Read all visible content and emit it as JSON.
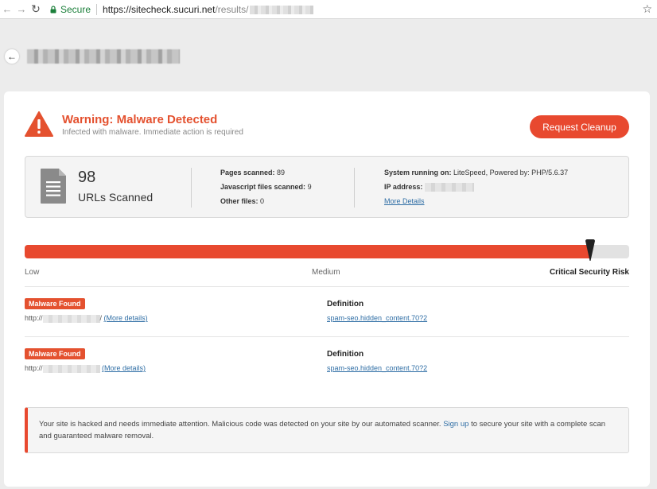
{
  "browser": {
    "secure_label": "Secure",
    "url_host": "https://sitecheck.sucuri.net",
    "url_path": "/results/",
    "back_icon": "arrow-left-icon",
    "forward_icon": "arrow-right-icon",
    "reload_icon": "reload-icon",
    "bookmark_icon": "star-icon"
  },
  "warning": {
    "title": "Warning: Malware Detected",
    "subtitle": "Infected with malware. Immediate action is required",
    "cleanup_button": "Request Cleanup",
    "icon": "warning-triangle-icon"
  },
  "stats": {
    "urls_count": "98",
    "urls_label": "URLs Scanned",
    "pages_label": "Pages scanned:",
    "pages_value": "89",
    "js_label": "Javascript files scanned:",
    "js_value": "9",
    "other_label": "Other files:",
    "other_value": "0",
    "system_label": "System running on:",
    "system_value": "LiteSpeed, Powered by: PHP/5.6.37",
    "ip_label": "IP address:",
    "more_details": "More Details"
  },
  "risk": {
    "level_fraction": 0.935,
    "low": "Low",
    "medium": "Medium",
    "high": "Critical Security Risk"
  },
  "findings": [
    {
      "badge": "Malware Found",
      "url_prefix": "http://",
      "url_suffix": "/",
      "more": "(More details)",
      "definition_label": "Definition",
      "definition": "spam-seo.hidden_content.70?2"
    },
    {
      "badge": "Malware Found",
      "url_prefix": "http://",
      "url_suffix": "",
      "more": "(More details)",
      "definition_label": "Definition",
      "definition": "spam-seo.hidden_content.70?2"
    }
  ],
  "notice": {
    "text_before": "Your site is hacked and needs immediate attention. Malicious code was detected on your site by our automated scanner. ",
    "signup": "Sign up",
    "text_after": " to secure your site with a complete scan and guaranteed malware removal."
  },
  "colors": {
    "accent": "#e8492f",
    "link": "#2f6ea5",
    "secure": "#1b7f3a"
  }
}
